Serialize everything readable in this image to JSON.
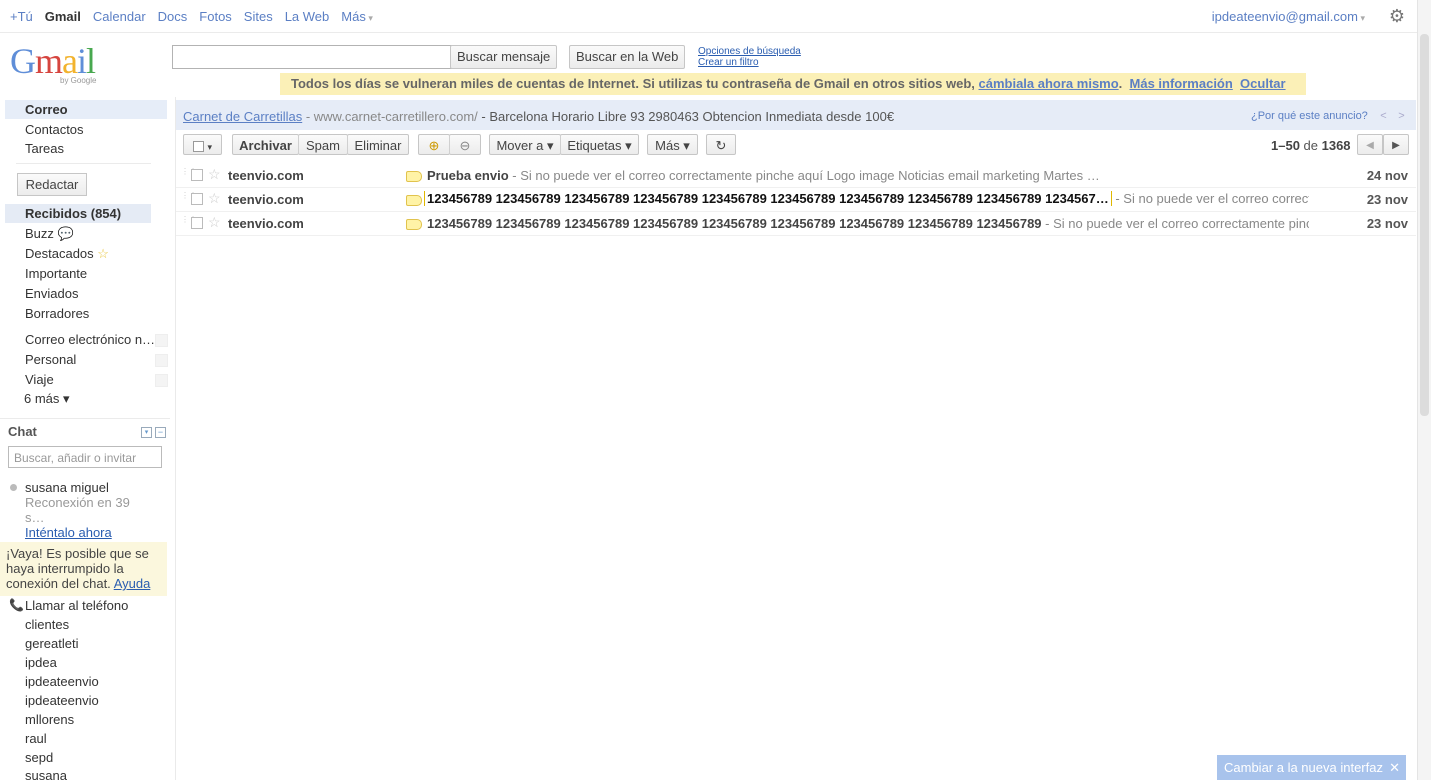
{
  "topbar": {
    "nav": [
      "+Tú",
      "Gmail",
      "Calendar",
      "Docs",
      "Fotos",
      "Sites",
      "La Web",
      "Más"
    ],
    "account": "ipdeateenvio@gmail.com"
  },
  "logo": {
    "sub": "by Google"
  },
  "search": {
    "mail_button": "Buscar mensaje",
    "web_button": "Buscar en la Web",
    "options_link": "Opciones de búsqueda",
    "filter_link": "Crear un filtro"
  },
  "warning": {
    "text": "Todos los días se vulneran miles de cuentas de Internet. Si utilizas tu contraseña de Gmail en otros sitios web, ",
    "change_link": "cámbiala ahora mismo",
    "more_link": "Más información",
    "hide_link": "Ocultar"
  },
  "sidebar": {
    "top": [
      "Correo",
      "Contactos",
      "Tareas"
    ],
    "compose": "Redactar",
    "folders": [
      "Recibidos (854)",
      "Buzz",
      "Destacados",
      "Importante",
      "Enviados",
      "Borradores"
    ],
    "labels": [
      "Correo electrónico n…",
      "Personal",
      "Viaje"
    ],
    "more": "6 más ▾"
  },
  "chat": {
    "header": "Chat",
    "search_placeholder": "Buscar, añadir o invitar",
    "user": "susana miguel",
    "status": "Reconexión en 39 s…",
    "retry": "Inténtalo ahora",
    "warning": "¡Vaya! Es posible que se haya interrumpido la conexión del chat. ",
    "help": "Ayuda",
    "call": "Llamar al teléfono",
    "contacts": [
      "clientes",
      "gereatleti",
      "ipdea",
      "ipdeateenvio",
      "ipdeateenvio",
      "mllorens",
      "raul",
      "sepd",
      "susana"
    ]
  },
  "ad": {
    "title": "Carnet de Carretillas",
    "url": " - www.carnet-carretillero.com/",
    "text": " - Barcelona Horario Libre 93 2980463 Obtencion Inmediata desde 100€",
    "why": "¿Por qué este anuncio?"
  },
  "toolbar": {
    "archive": "Archivar",
    "spam": "Spam",
    "delete": "Eliminar",
    "move": "Mover a ▾",
    "labels": "Etiquetas ▾",
    "more": "Más ▾",
    "range": "1–50",
    "of": " de ",
    "total": "1368"
  },
  "emails": [
    {
      "sender": "teenvio.com",
      "subject": "Prueba envio",
      "snippet": " - Si no puede ver el correo correctamente pinche aquí Logo image Noticias email marketing Martes …",
      "date": "24 nov"
    },
    {
      "sender": "teenvio.com",
      "subject": "123456789 123456789 123456789 123456789 123456789 123456789 123456789 123456789 123456789 1234567…",
      "snippet": " - Si no puede ver el correo correctamente pinche",
      "date": "23 nov"
    },
    {
      "sender": "teenvio.com",
      "subject": "123456789 123456789 123456789 123456789 123456789 123456789 123456789 123456789 123456789",
      "snippet": " - Si no puede ver el correo correctamente pinche",
      "date": "23 nov"
    }
  ],
  "footer": {
    "new_ui": "Cambiar a la nueva interfaz"
  },
  "colors": {
    "accent": "#5b7fc4",
    "warning_bg": "#fbf0b7",
    "selected_bg": "#e5ebf5"
  }
}
